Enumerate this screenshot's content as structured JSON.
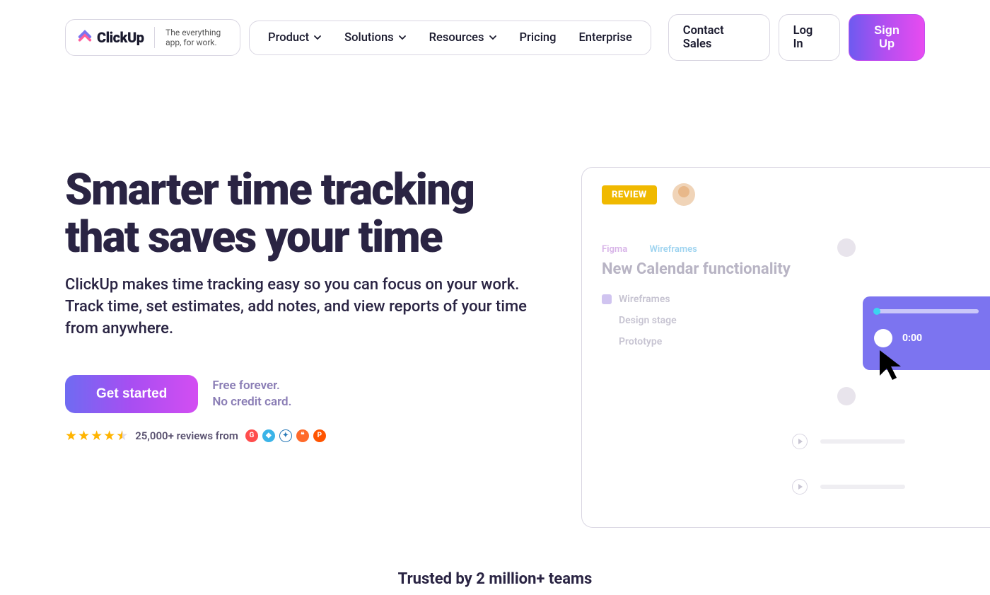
{
  "brand": {
    "name": "ClickUp",
    "tagline": "The everything app, for work."
  },
  "nav": {
    "items": [
      {
        "label": "Product",
        "dropdown": true
      },
      {
        "label": "Solutions",
        "dropdown": true
      },
      {
        "label": "Resources",
        "dropdown": true
      },
      {
        "label": "Pricing",
        "dropdown": false
      },
      {
        "label": "Enterprise",
        "dropdown": false
      }
    ],
    "contact": "Contact Sales",
    "login": "Log In",
    "signup": "Sign Up"
  },
  "hero": {
    "headline": "Smarter time tracking that saves your time",
    "subhead": "ClickUp makes time tracking easy so you can focus on your work. Track time, set estimates, add notes, and view reports of your time from anywhere.",
    "cta": "Get started",
    "cta_note_line1": "Free forever.",
    "cta_note_line2": "No credit card.",
    "reviews_text": "25,000+ reviews from",
    "review_sources": [
      "G2",
      "GetApp",
      "Capterra",
      "TrustRadius",
      "ProductHunt"
    ]
  },
  "mock": {
    "badge": "REVIEW",
    "tag1": "Figma",
    "tag2": "Wireframes",
    "title": "New Calendar functionality",
    "items": [
      "Wireframes",
      "Design stage",
      "Prototype"
    ],
    "timer": "0:00"
  },
  "trusted": "Trusted by 2 million+ teams"
}
